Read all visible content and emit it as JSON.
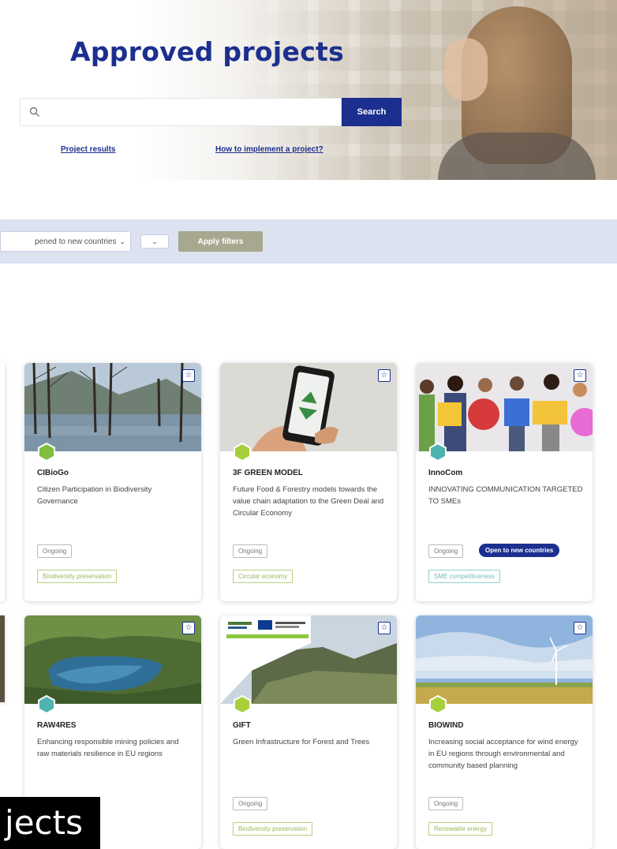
{
  "hero": {
    "title": "Approved projects",
    "search": {
      "placeholder": "",
      "button_label": "Search",
      "icon": "search-icon"
    },
    "links": [
      "Project results",
      "How to implement a project?"
    ]
  },
  "filters": {
    "select_value": "pened to new countries",
    "small_select_value": "",
    "apply_label": "Apply filters"
  },
  "cards": [
    {
      "acronym": "CIBioGo",
      "description": "Citizen Participation in Biodiversity Governance",
      "status": "Ongoing",
      "badge": "",
      "topic": "Biodiversity preservation",
      "hex_color": "#7fbf3f"
    },
    {
      "acronym": "3F GREEN MODEL",
      "description": "Future Food & Forestry models towards the value chain adaptation to the Green Deal and Circular Economy",
      "status": "Ongoing",
      "badge": "",
      "topic": "Circular economy",
      "hex_color": "#a7cf3a"
    },
    {
      "acronym": "InnoCom",
      "description": "INNOVATING COMMUNICATION TARGETED TO SMEs",
      "status": "Ongoing",
      "badge": "Open to new countries",
      "topic": "SME competitiveness",
      "hex_color": "#4fb3b0"
    },
    {
      "acronym": "RAW4RES",
      "description": "Enhancing responsible mining policies and raw materials resilience in EU regions",
      "status": "",
      "badge": "",
      "topic": "",
      "hex_color": "#4fb3b0"
    },
    {
      "acronym": "GIFT",
      "description": "Green Infrastructure for Forest and Trees",
      "status": "Ongoing",
      "badge": "",
      "topic": "Biodiversity preservation",
      "hex_color": "#a7cf3a"
    },
    {
      "acronym": "BIOWIND",
      "description": "Increasing social acceptance for wind energy in EU regions through environmental and community based planning",
      "status": "Ongoing",
      "badge": "",
      "topic": "Renewable energy",
      "hex_color": "#a7cf3a"
    }
  ],
  "caption": "jects",
  "colors": {
    "brand": "#1c2f8f",
    "filter_bar": "#dde2f0",
    "topic_green": "#9ab85d"
  }
}
